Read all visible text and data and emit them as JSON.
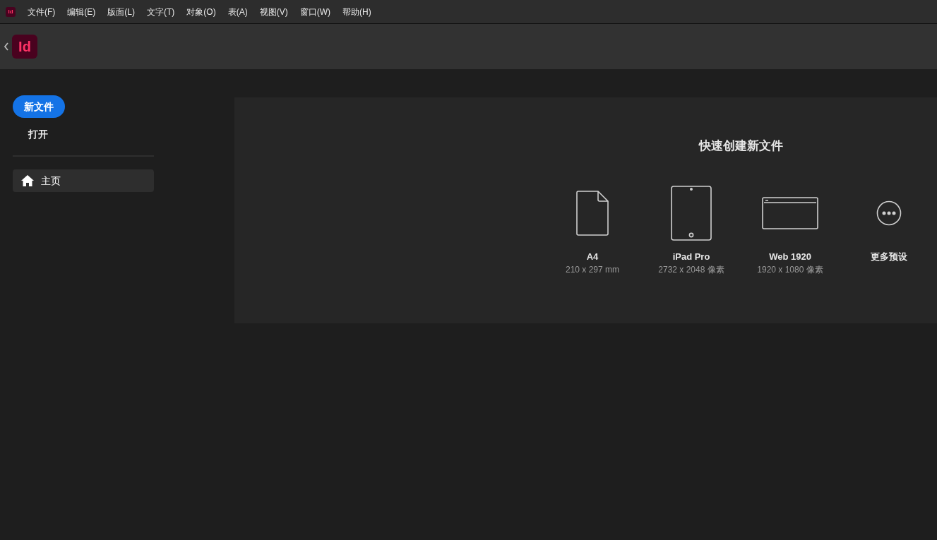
{
  "menu_bar": {
    "app_icon": "Id",
    "items": [
      "文件(F)",
      "编辑(E)",
      "版面(L)",
      "文字(T)",
      "对象(O)",
      "表(A)",
      "视图(V)",
      "窗口(W)",
      "帮助(H)"
    ]
  },
  "header": {
    "logo": "Id"
  },
  "sidebar": {
    "actions": [
      {
        "label": "新文件",
        "kind": "primary"
      },
      {
        "label": "打开",
        "kind": "plain"
      }
    ],
    "nav": [
      {
        "label": "主页",
        "selected": true
      }
    ]
  },
  "quick_create": {
    "title": "快速创建新文件",
    "presets": [
      {
        "kind": "page",
        "name": "A4",
        "size": "210 x 297 mm"
      },
      {
        "kind": "tablet",
        "name": "iPad Pro",
        "size": "2732 x 2048 像素"
      },
      {
        "kind": "web",
        "name": "Web 1920",
        "size": "1920 x 1080 像素"
      },
      {
        "kind": "more",
        "name": "更多预设"
      }
    ]
  }
}
